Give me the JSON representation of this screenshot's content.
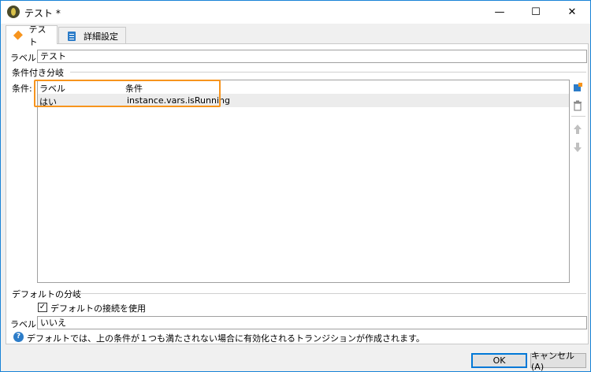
{
  "window": {
    "title": "テスト *",
    "min": "—",
    "max": "☐",
    "close": "✕"
  },
  "tabs": [
    {
      "label": "テスト",
      "icon": "diamond-icon",
      "active": true
    },
    {
      "label": "詳細設定",
      "icon": "clipboard-icon",
      "active": false
    }
  ],
  "label_field": {
    "label": "ラベル:",
    "value": "テスト"
  },
  "conditional": {
    "section_title": "条件付き分岐",
    "conditions_label": "条件:",
    "columns": [
      "ラベル",
      "条件"
    ],
    "rows": [
      {
        "label": "はい",
        "condition": "instance.vars.isRunning"
      }
    ]
  },
  "default_branch": {
    "section_title": "デフォルトの分岐",
    "checkbox_label": "デフォルトの接続を使用",
    "checkbox_checked": true,
    "label": "ラベル:",
    "value": "いいえ"
  },
  "info_text": "デフォルトでは、上の条件が１つも満たされない場合に有効化されるトランジションが作成されます。",
  "buttons": {
    "ok": "OK",
    "cancel": "キャンセル(A)"
  },
  "colors": {
    "accent": "#f7941d",
    "border_active": "#0078d7",
    "info": "#2c7cc8"
  }
}
